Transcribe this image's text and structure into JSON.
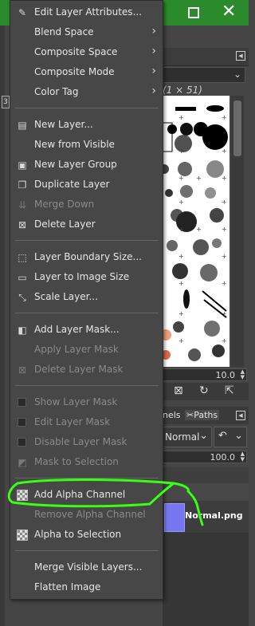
{
  "menu": {
    "items": [
      {
        "label": "Edit Layer Attributes...",
        "icon": "edit-layer-attributes-icon",
        "enabled": true
      },
      {
        "label": "Blend Space",
        "submenu": true,
        "enabled": true
      },
      {
        "label": "Composite Space",
        "submenu": true,
        "enabled": true
      },
      {
        "label": "Composite Mode",
        "submenu": true,
        "enabled": true
      },
      {
        "label": "Color Tag",
        "submenu": true,
        "enabled": true
      },
      {
        "label": "New Layer...",
        "icon": "new-layer-icon",
        "enabled": true
      },
      {
        "label": "New from Visible",
        "enabled": true
      },
      {
        "label": "New Layer Group",
        "icon": "new-layer-group-icon",
        "enabled": true
      },
      {
        "label": "Duplicate Layer",
        "icon": "duplicate-layer-icon",
        "enabled": true
      },
      {
        "label": "Merge Down",
        "icon": "merge-down-icon",
        "enabled": false
      },
      {
        "label": "Delete Layer",
        "icon": "delete-layer-icon",
        "enabled": true
      },
      {
        "label": "Layer Boundary Size...",
        "icon": "layer-boundary-size-icon",
        "enabled": true
      },
      {
        "label": "Layer to Image Size",
        "icon": "layer-to-image-size-icon",
        "enabled": true
      },
      {
        "label": "Scale Layer...",
        "icon": "scale-layer-icon",
        "enabled": true
      },
      {
        "label": "Add Layer Mask...",
        "icon": "add-layer-mask-icon",
        "enabled": true
      },
      {
        "label": "Apply Layer Mask",
        "enabled": false
      },
      {
        "label": "Delete Layer Mask",
        "icon": "delete-layer-mask-icon",
        "enabled": false
      },
      {
        "label": "Show Layer Mask",
        "checkbox": true,
        "enabled": false
      },
      {
        "label": "Edit Layer Mask",
        "checkbox": true,
        "enabled": false
      },
      {
        "label": "Disable Layer Mask",
        "checkbox": true,
        "enabled": false
      },
      {
        "label": "Mask to Selection",
        "icon": "mask-to-selection-icon",
        "enabled": false
      },
      {
        "label": "Add Alpha Channel",
        "icon": "add-alpha-channel-icon",
        "enabled": true,
        "highlighted": true
      },
      {
        "label": "Remove Alpha Channel",
        "enabled": false
      },
      {
        "label": "Alpha to Selection",
        "icon": "alpha-to-selection-icon",
        "enabled": true
      },
      {
        "label": "Merge Visible Layers...",
        "enabled": true
      },
      {
        "label": "Flatten Image",
        "enabled": true
      }
    ]
  },
  "background": {
    "brush_size_label": "(1 × 51)",
    "spacing_value": "10.0",
    "tabs": [
      "nels",
      "Paths"
    ],
    "mode_label": "Normal",
    "opacity_value": "100.0",
    "layer_name": "Normal.png",
    "left_strip_mark": "3"
  },
  "colors": {
    "titlebar": "#2b8a2b",
    "menu_bg": "#474747",
    "annotation": "#39ff14"
  }
}
